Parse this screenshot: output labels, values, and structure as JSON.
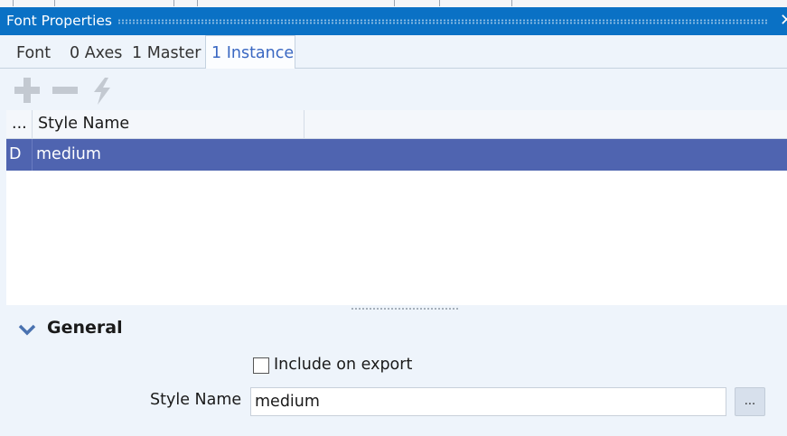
{
  "window": {
    "title": "Font Properties",
    "close_glyph": "✕"
  },
  "tabs": [
    {
      "label": "Font",
      "active": false
    },
    {
      "label": "0 Axes",
      "active": false
    },
    {
      "label": "1 Master",
      "active": false
    },
    {
      "label": "1 Instance",
      "active": true
    }
  ],
  "toolbar": {
    "icons": [
      "add-icon",
      "remove-icon",
      "lightning-icon"
    ],
    "icon_color": "#c3c9d1"
  },
  "grid": {
    "columns": [
      {
        "label": "..."
      },
      {
        "label": "Style Name"
      }
    ],
    "rows": [
      {
        "flag": "D",
        "style_name": "medium",
        "selected": true
      }
    ],
    "selection_color": "#4f64b0"
  },
  "general": {
    "title": "General",
    "include_on_export_label": "Include on export",
    "include_on_export_checked": false,
    "style_name_label": "Style Name",
    "style_name_value": "medium",
    "browse_label": "..."
  },
  "colors": {
    "titlebar": "#0a71c5",
    "panel_bg": "#eef4fb",
    "active_tab_text": "#3a68c2",
    "chevron": "#4a72b0"
  }
}
